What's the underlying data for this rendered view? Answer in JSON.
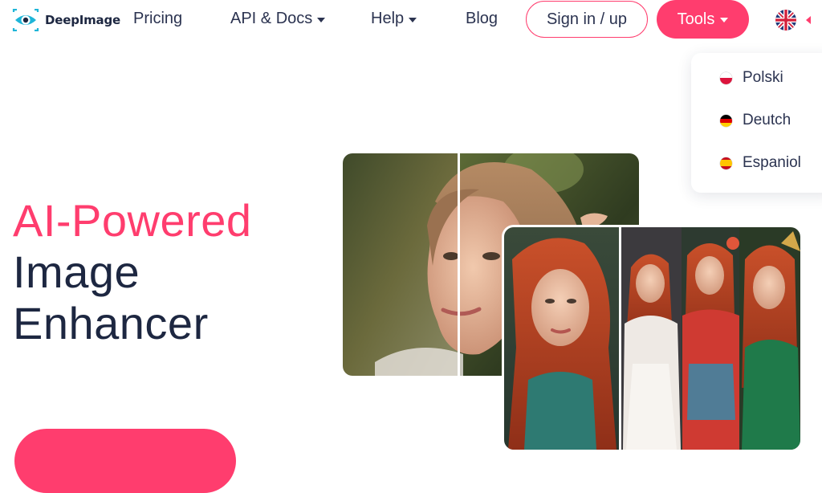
{
  "brand": {
    "name": "DeepImage"
  },
  "nav": {
    "pricing": "Pricing",
    "api_docs": "API & Docs",
    "help": "Help",
    "blog": "Blog",
    "signin": "Sign in / up",
    "tools": "Tools",
    "language_icon": "uk-flag-icon"
  },
  "language_menu": {
    "items": [
      {
        "label": "Polski",
        "icon": "poland-flag-icon"
      },
      {
        "label": "Deutch",
        "icon": "germany-flag-icon"
      },
      {
        "label": "Espaniol",
        "icon": "spain-flag-icon"
      }
    ]
  },
  "hero": {
    "line1": "AI-Powered",
    "line2": "Image",
    "line3": "Enhancer"
  },
  "colors": {
    "accent": "#ff3d6e",
    "text_dark": "#1d2741"
  }
}
